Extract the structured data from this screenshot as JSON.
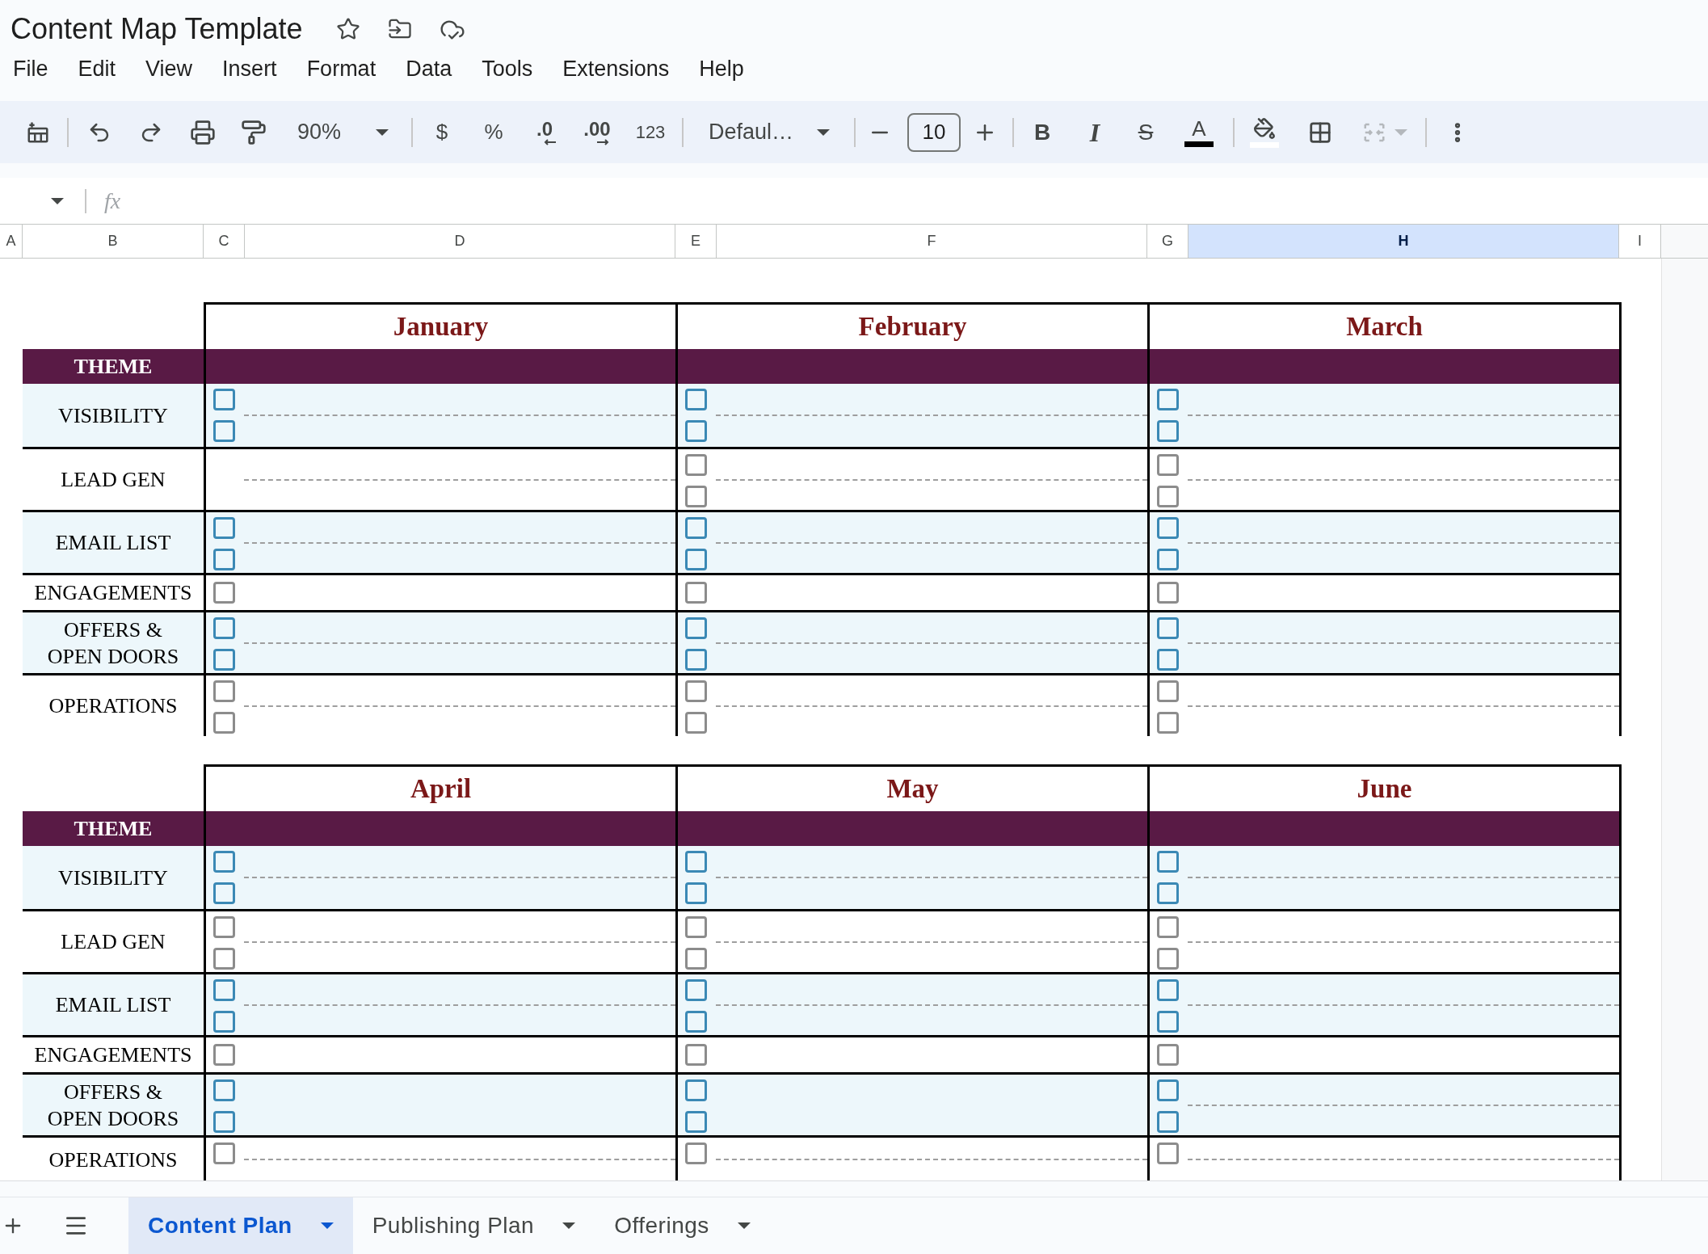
{
  "document": {
    "title": "Content Map Template"
  },
  "menu": [
    "File",
    "Edit",
    "View",
    "Insert",
    "Format",
    "Data",
    "Tools",
    "Extensions",
    "Help"
  ],
  "toolbar": {
    "zoom": "90%",
    "currency": "$",
    "percent": "%",
    "decrease_decimal": ".0",
    "increase_decimal": ".00",
    "number_format": "123",
    "font": "Defaul…",
    "font_size": "10",
    "bold": "B",
    "italic": "I",
    "strikethrough": "S",
    "text_color": "A",
    "merge_cells": {
      "disabled": true
    }
  },
  "formula_bar": {
    "function_label": "fx"
  },
  "columns": [
    {
      "label": "A",
      "selected": false
    },
    {
      "label": "B",
      "selected": false
    },
    {
      "label": "C",
      "selected": false
    },
    {
      "label": "D",
      "selected": false
    },
    {
      "label": "E",
      "selected": false
    },
    {
      "label": "F",
      "selected": false
    },
    {
      "label": "G",
      "selected": false
    },
    {
      "label": "H",
      "selected": true
    },
    {
      "label": "I",
      "selected": false
    }
  ],
  "blocks": [
    {
      "months": [
        "January",
        "February",
        "March"
      ],
      "theme": "THEME",
      "rows": [
        {
          "label": "VISIBILITY",
          "kind": "double",
          "shaded": true,
          "cells": [
            {
              "writing_line": true,
              "checkboxes": [
                {
                  "checked": false
                },
                {
                  "checked": false
                }
              ]
            },
            {
              "writing_line": true,
              "checkboxes": [
                {
                  "checked": false
                },
                {
                  "checked": false
                }
              ]
            },
            {
              "writing_line": true,
              "checkboxes": [
                {
                  "checked": false
                },
                {
                  "checked": false
                }
              ]
            }
          ]
        },
        {
          "label": "LEAD GEN",
          "kind": "double",
          "shaded": false,
          "cells": [
            {
              "writing_line": true
            },
            {
              "writing_line": true,
              "checkboxes": [
                {
                  "checked": false
                },
                {
                  "checked": false
                }
              ]
            },
            {
              "writing_line": true,
              "checkboxes": [
                {
                  "checked": false
                },
                {
                  "checked": false
                }
              ]
            }
          ]
        },
        {
          "label": "EMAIL LIST",
          "kind": "double",
          "shaded": true,
          "cells": [
            {
              "writing_line": true,
              "checkboxes": [
                {
                  "checked": false
                },
                {
                  "checked": false
                }
              ]
            },
            {
              "writing_line": true,
              "checkboxes": [
                {
                  "checked": false
                },
                {
                  "checked": false
                }
              ]
            },
            {
              "writing_line": true,
              "checkboxes": [
                {
                  "checked": false
                },
                {
                  "checked": false
                }
              ]
            }
          ]
        },
        {
          "label": "ENGAGEMENTS",
          "kind": "single",
          "shaded": false,
          "cells": [
            {
              "writing_line": false,
              "checkboxes": [
                {
                  "checked": false
                }
              ]
            },
            {
              "writing_line": false,
              "checkboxes": [
                {
                  "checked": false
                }
              ]
            },
            {
              "writing_line": false,
              "checkboxes": [
                {
                  "checked": false
                }
              ]
            }
          ]
        },
        {
          "label": "OFFERS &\nOPEN DOORS",
          "kind": "double",
          "shaded": true,
          "cells": [
            {
              "writing_line": true,
              "checkboxes": [
                {
                  "checked": false
                },
                {
                  "checked": false
                }
              ]
            },
            {
              "writing_line": true,
              "checkboxes": [
                {
                  "checked": false
                },
                {
                  "checked": false
                }
              ]
            },
            {
              "writing_line": true,
              "checkboxes": [
                {
                  "checked": false
                },
                {
                  "checked": false
                }
              ]
            }
          ]
        },
        {
          "label": "OPERATIONS",
          "kind": "double",
          "shaded": false,
          "cells": [
            {
              "writing_line": true,
              "checkboxes": [
                {
                  "checked": false
                },
                {
                  "checked": false
                }
              ]
            },
            {
              "writing_line": true,
              "checkboxes": [
                {
                  "checked": false
                },
                {
                  "checked": false
                }
              ]
            },
            {
              "writing_line": true,
              "checkboxes": [
                {
                  "checked": false
                },
                {
                  "checked": false
                }
              ]
            }
          ]
        }
      ]
    },
    {
      "months": [
        "April",
        "May",
        "June"
      ],
      "theme": "THEME",
      "rows": [
        {
          "label": "VISIBILITY",
          "kind": "double",
          "shaded": true,
          "cells": [
            {
              "writing_line": true,
              "checkboxes": [
                {
                  "checked": false
                },
                {
                  "checked": false
                }
              ]
            },
            {
              "writing_line": true,
              "checkboxes": [
                {
                  "checked": false
                },
                {
                  "checked": false
                }
              ]
            },
            {
              "writing_line": true,
              "checkboxes": [
                {
                  "checked": false
                },
                {
                  "checked": false
                }
              ]
            }
          ]
        },
        {
          "label": "LEAD GEN",
          "kind": "double",
          "shaded": false,
          "cells": [
            {
              "writing_line": true,
              "checkboxes": [
                {
                  "checked": false
                },
                {
                  "checked": false
                }
              ]
            },
            {
              "writing_line": true,
              "checkboxes": [
                {
                  "checked": false
                },
                {
                  "checked": false
                }
              ]
            },
            {
              "writing_line": true,
              "checkboxes": [
                {
                  "checked": false
                },
                {
                  "checked": false
                }
              ]
            }
          ]
        },
        {
          "label": "EMAIL LIST",
          "kind": "double",
          "shaded": true,
          "cells": [
            {
              "writing_line": true,
              "checkboxes": [
                {
                  "checked": false
                },
                {
                  "checked": false
                }
              ]
            },
            {
              "writing_line": true,
              "checkboxes": [
                {
                  "checked": false
                },
                {
                  "checked": false
                }
              ]
            },
            {
              "writing_line": true,
              "checkboxes": [
                {
                  "checked": false
                },
                {
                  "checked": false
                }
              ]
            }
          ]
        },
        {
          "label": "ENGAGEMENTS",
          "kind": "single",
          "shaded": false,
          "cells": [
            {
              "writing_line": false,
              "checkboxes": [
                {
                  "checked": false
                }
              ]
            },
            {
              "writing_line": false,
              "checkboxes": [
                {
                  "checked": false
                }
              ]
            },
            {
              "writing_line": false,
              "checkboxes": [
                {
                  "checked": false
                }
              ]
            }
          ]
        },
        {
          "label": "OFFERS &\nOPEN DOORS",
          "kind": "double",
          "shaded": true,
          "cells": [
            {
              "writing_line": false,
              "checkboxes": [
                {
                  "checked": false
                },
                {
                  "checked": false
                }
              ]
            },
            {
              "writing_line": false,
              "checkboxes": [
                {
                  "checked": false
                },
                {
                  "checked": false
                }
              ]
            },
            {
              "writing_line": true,
              "checkboxes": [
                {
                  "checked": false
                },
                {
                  "checked": false
                }
              ]
            }
          ]
        },
        {
          "label": "OPERATIONS",
          "kind": "double",
          "shaded": false,
          "cells": [
            {
              "writing_line": true,
              "checkboxes": [
                {
                  "checked": false
                }
              ]
            },
            {
              "writing_line": true,
              "checkboxes": [
                {
                  "checked": false
                }
              ]
            },
            {
              "writing_line": true,
              "checkboxes": [
                {
                  "checked": false
                }
              ]
            }
          ]
        }
      ]
    }
  ],
  "sheet_tabs": [
    {
      "label": "Content Plan",
      "selected": true
    },
    {
      "label": "Publishing Plan",
      "selected": false
    },
    {
      "label": "Offerings",
      "selected": false
    }
  ]
}
